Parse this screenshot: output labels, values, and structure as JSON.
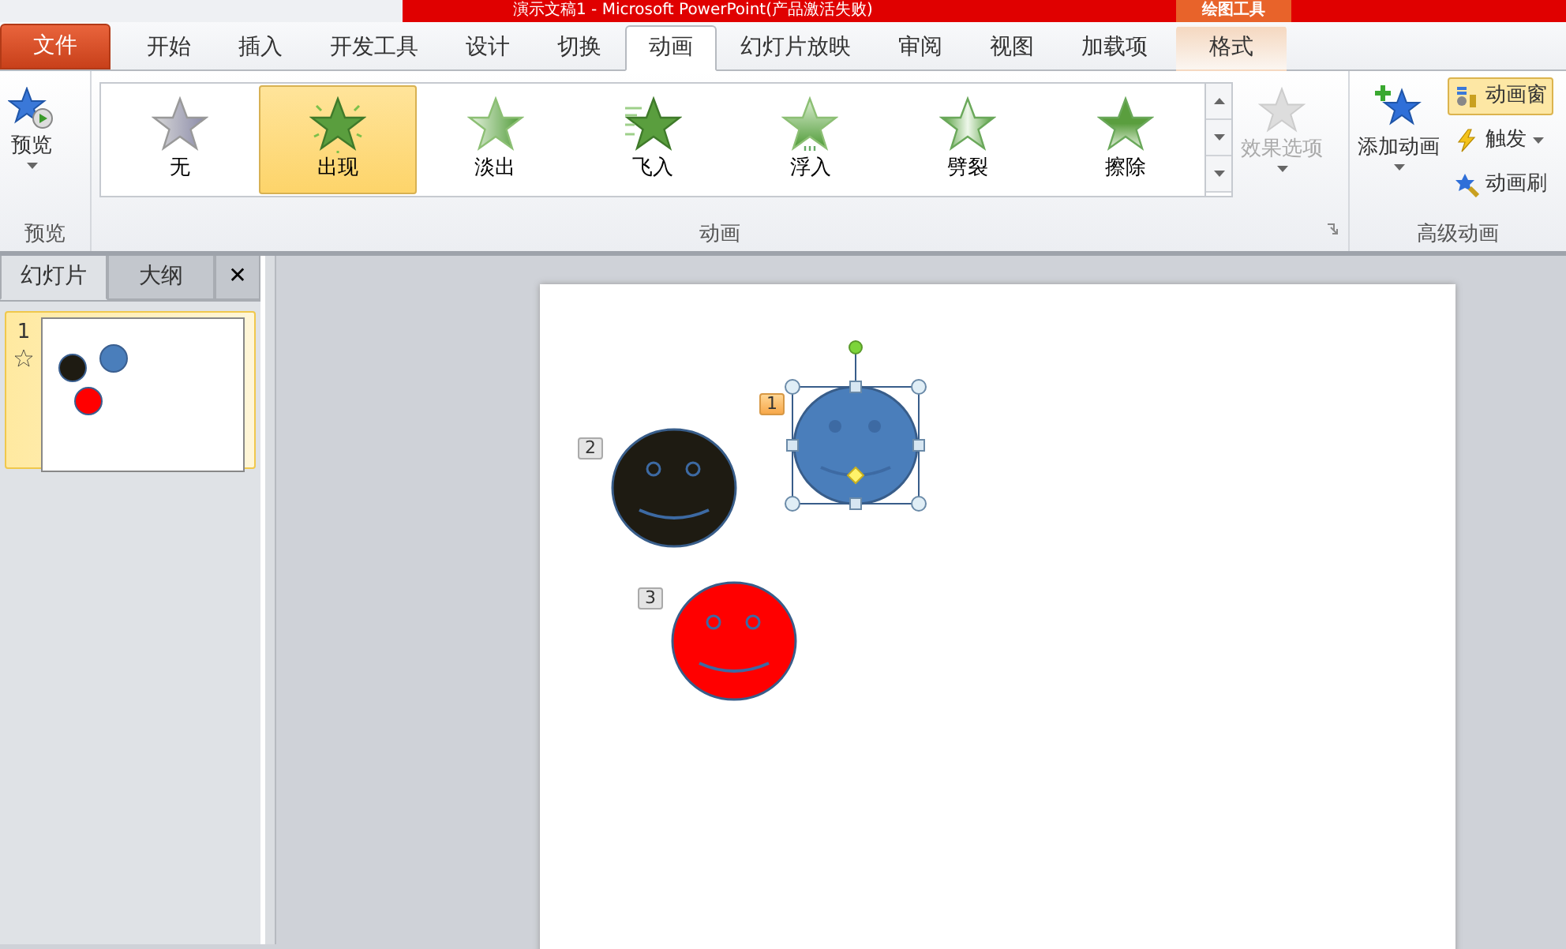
{
  "window": {
    "title": "演示文稿1 - Microsoft PowerPoint(产品激活失败)",
    "context_tab": "绘图工具"
  },
  "file_tab": "文件",
  "tabs": [
    {
      "label": "开始",
      "selected": false
    },
    {
      "label": "插入",
      "selected": false
    },
    {
      "label": "开发工具",
      "selected": false
    },
    {
      "label": "设计",
      "selected": false
    },
    {
      "label": "切换",
      "selected": false
    },
    {
      "label": "动画",
      "selected": true
    },
    {
      "label": "幻灯片放映",
      "selected": false
    },
    {
      "label": "审阅",
      "selected": false
    },
    {
      "label": "视图",
      "selected": false
    },
    {
      "label": "加载项",
      "selected": false
    },
    {
      "label": "格式",
      "selected": false,
      "kind": "context"
    }
  ],
  "ribbon": {
    "preview": {
      "label": "预览",
      "group": "预览"
    },
    "gallery": {
      "group": "动画",
      "items": [
        {
          "label": "无",
          "kind": "none",
          "selected": false
        },
        {
          "label": "出现",
          "kind": "appear",
          "selected": true
        },
        {
          "label": "淡出",
          "kind": "fade",
          "selected": false
        },
        {
          "label": "飞入",
          "kind": "fly",
          "selected": false
        },
        {
          "label": "浮入",
          "kind": "float",
          "selected": false
        },
        {
          "label": "劈裂",
          "kind": "split",
          "selected": false
        },
        {
          "label": "擦除",
          "kind": "wipe",
          "selected": false
        }
      ]
    },
    "effect_options": {
      "label": "效果选项",
      "disabled": true
    },
    "advanced": {
      "group": "高级动画",
      "add": "添加动画",
      "items": [
        {
          "label": "动画窗",
          "kind": "pane",
          "selected": true
        },
        {
          "label": "触发",
          "kind": "trigger",
          "selected": false
        },
        {
          "label": "动画刷",
          "kind": "painter",
          "selected": false
        }
      ]
    }
  },
  "side_pane": {
    "tabs": [
      {
        "label": "幻灯片",
        "selected": true
      },
      {
        "label": "大纲",
        "selected": false
      }
    ],
    "close": "✕",
    "slides": [
      {
        "number": "1",
        "selected": true
      }
    ]
  },
  "slide": {
    "shapes": [
      {
        "order": "1",
        "color": "#4a7ebb",
        "selected": true
      },
      {
        "order": "2",
        "color": "#1e1b12",
        "selected": false
      },
      {
        "order": "3",
        "color": "#ff0000",
        "selected": false
      }
    ]
  }
}
